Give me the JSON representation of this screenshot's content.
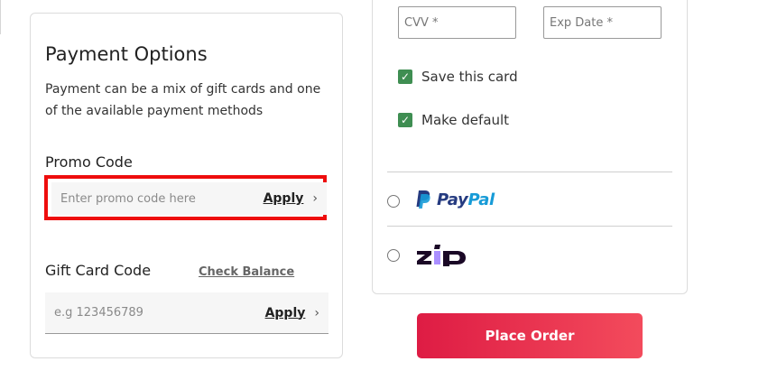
{
  "payment_options": {
    "title": "Payment Options",
    "description": "Payment can be a mix of gift cards and one of the available payment methods",
    "promo": {
      "label": "Promo Code",
      "placeholder": "Enter promo code here",
      "apply_label": "Apply",
      "chevron": "›"
    },
    "gift_card": {
      "label": "Gift Card Code",
      "check_balance_label": "Check Balance",
      "placeholder": "e.g 123456789",
      "apply_label": "Apply",
      "chevron": "›"
    }
  },
  "card_details": {
    "cvv_placeholder": "CVV *",
    "exp_placeholder": "Exp Date *",
    "save_card": {
      "label": "Save this card",
      "checked": true
    },
    "make_default": {
      "label": "Make default",
      "checked": true
    }
  },
  "payment_methods": [
    {
      "name": "PayPal",
      "icon": "paypal-logo",
      "selected": false
    },
    {
      "name": "zip",
      "icon": "zip-logo",
      "selected": false
    }
  ],
  "place_order_label": "Place Order",
  "colors": {
    "highlight": "#ee0d0d",
    "checkbox": "#3f8e52",
    "paypal_dark": "#253b80",
    "paypal_light": "#179bd7",
    "zip_purple": "#aa8fff",
    "button_start": "#de1c44",
    "button_end": "#f34b5c"
  }
}
